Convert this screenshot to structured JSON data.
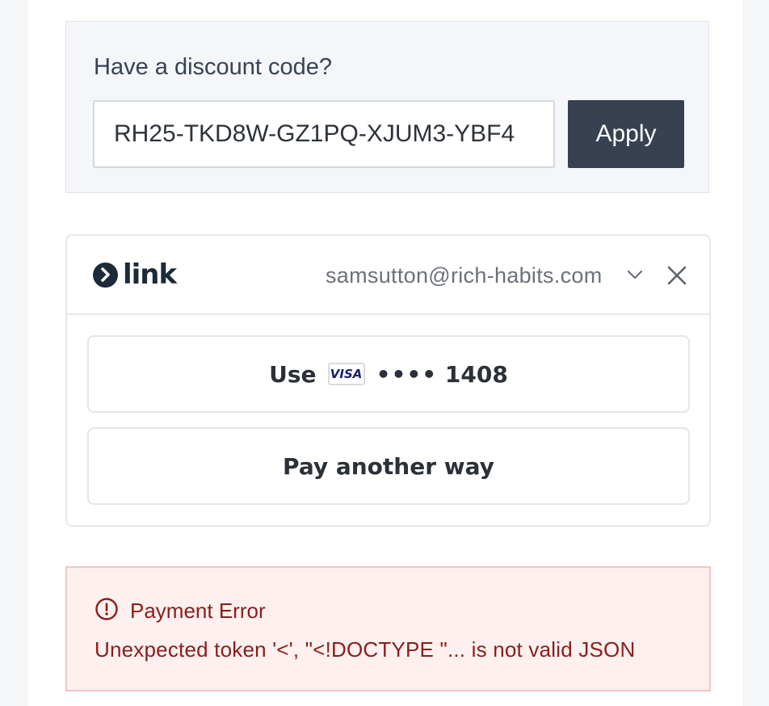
{
  "discount": {
    "label": "Have a discount code?",
    "code_value": "RH25-TKD8W-GZ1PQ-XJUM3-YBF4",
    "apply_label": "Apply"
  },
  "link": {
    "brand": "link",
    "email": "samsutton@rich-habits.com",
    "use_label": "Use",
    "card_brand": "VISA",
    "card_dots": "••••",
    "card_last4": "1408",
    "pay_another_label": "Pay another way"
  },
  "error": {
    "title": "Payment Error",
    "message": "Unexpected token '<', \"<!DOCTYPE \"... is not valid JSON"
  },
  "colors": {
    "apply_bg": "#374151",
    "error_text": "#8a1d1b",
    "error_bg": "#fdf0ef"
  }
}
